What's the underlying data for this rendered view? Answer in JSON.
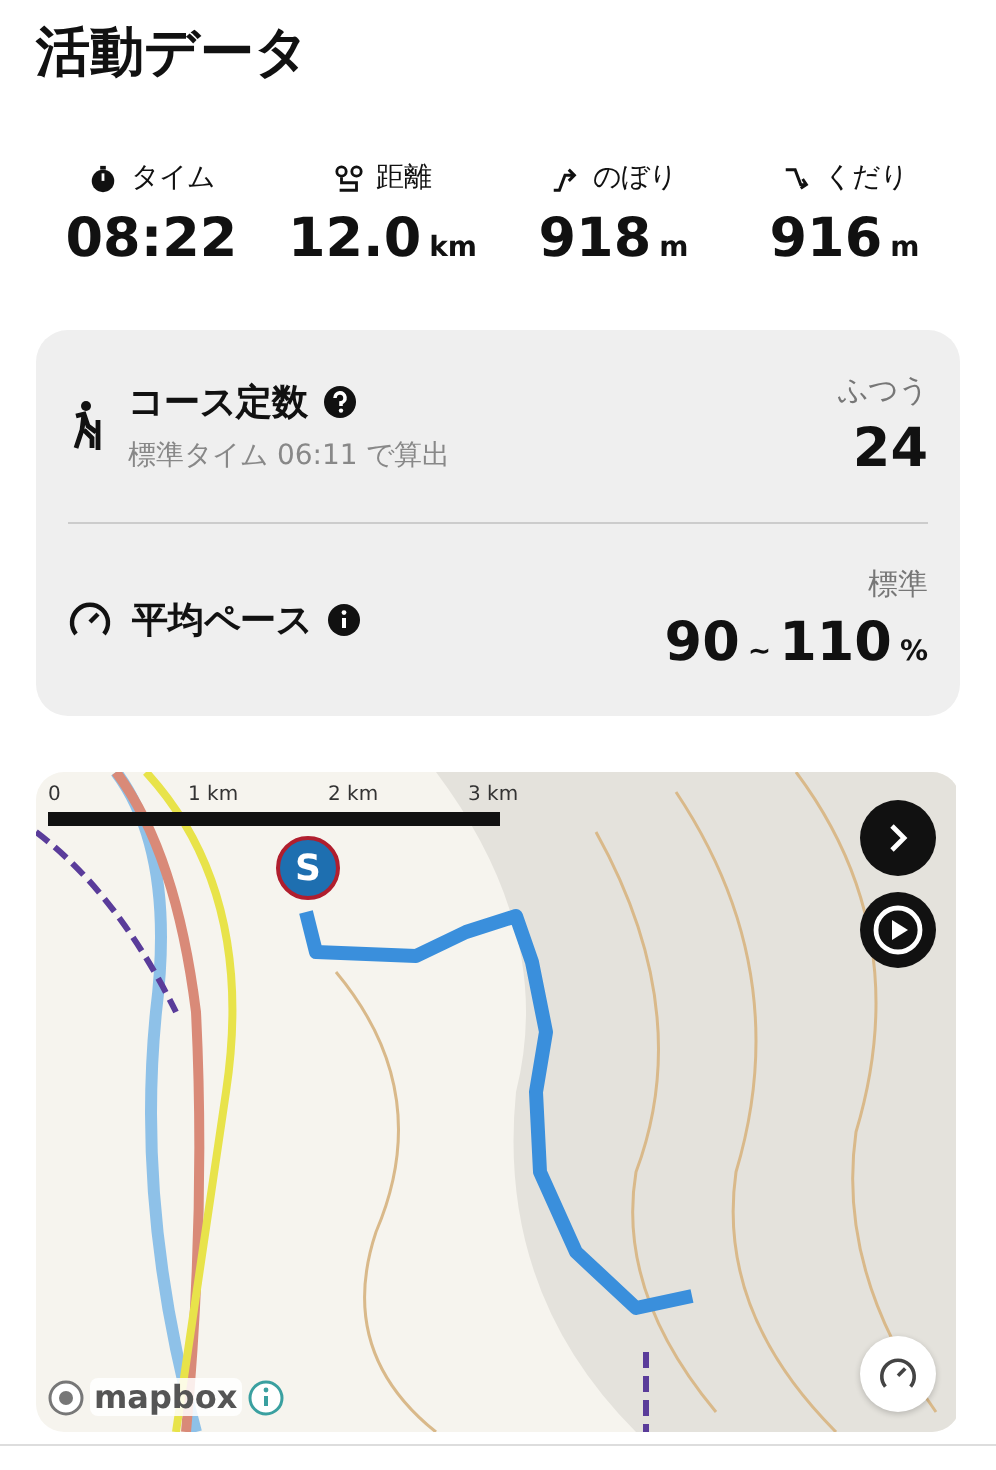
{
  "title": "活動データ",
  "stats": [
    {
      "kind": "time",
      "label": "タイム",
      "value": "08:22"
    },
    {
      "kind": "distance",
      "label": "距離",
      "value": "12.0",
      "unit": "km"
    },
    {
      "kind": "up",
      "label": "のぼり",
      "value": "918",
      "unit": "m"
    },
    {
      "kind": "down",
      "label": "くだり",
      "value": "916",
      "unit": "m"
    }
  ],
  "summary": [
    {
      "kind": "course",
      "label": "コース定数",
      "note": "標準タイム 06:11 で算出",
      "tag": "ふつう",
      "value": "24"
    },
    {
      "kind": "pace",
      "label": "平均ペース",
      "tag": "標準",
      "low": "90",
      "sep": "~",
      "high": "110",
      "unit": "%"
    }
  ],
  "map": {
    "scale": [
      "0",
      "1 km",
      "2 km",
      "3 km"
    ],
    "marker": "S",
    "attribution": "mapbox"
  }
}
